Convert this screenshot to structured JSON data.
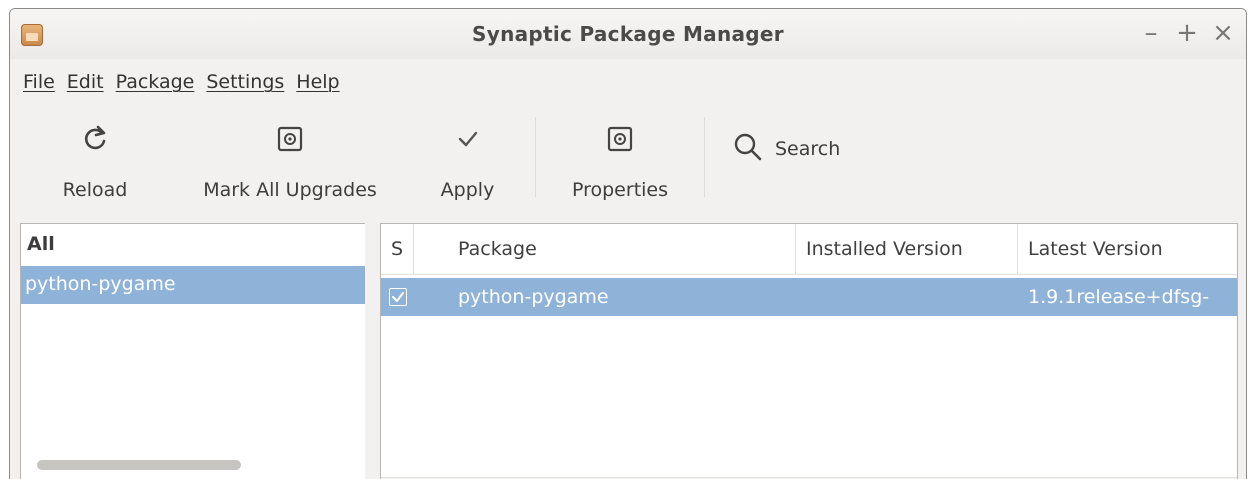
{
  "window": {
    "title": "Synaptic Package Manager",
    "controls": {
      "minimize": "–",
      "maximize": "+",
      "close": "×"
    }
  },
  "menu": [
    {
      "label": "File"
    },
    {
      "label": "Edit"
    },
    {
      "label": "Package"
    },
    {
      "label": "Settings"
    },
    {
      "label": "Help"
    }
  ],
  "toolbar": {
    "reload_label": "Reload",
    "mark_all_upgrades_label": "Mark All Upgrades",
    "apply_label": "Apply",
    "properties_label": "Properties",
    "search_label": "Search"
  },
  "filter_panel": {
    "header": "All",
    "items": [
      {
        "label": "python-pygame",
        "selected": true
      }
    ]
  },
  "package_table": {
    "columns": [
      {
        "label": "S"
      },
      {
        "label": "Package"
      },
      {
        "label": "Installed Version"
      },
      {
        "label": "Latest Version"
      }
    ],
    "rows": [
      {
        "status": "checked",
        "package": "python-pygame",
        "installed_version": "",
        "latest_version": "1.9.1release+dfsg-",
        "selected": true
      }
    ]
  },
  "colors": {
    "selection": "#8fb2d8",
    "window_bg": "#f2f1f0",
    "border": "#b8b5b2"
  }
}
